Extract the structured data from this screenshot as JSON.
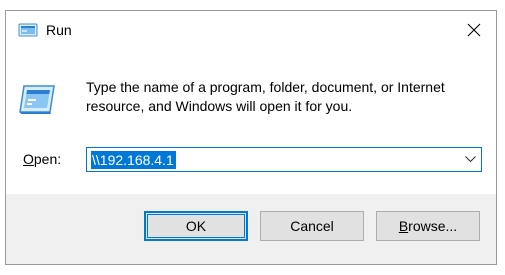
{
  "window": {
    "title": "Run",
    "close_glyph": "close-icon",
    "accent": "#0078d7"
  },
  "content": {
    "description_line1": "Type the name of a program, folder, document, or Internet",
    "description_line2": "resource, and Windows will open it for you.",
    "open_label_access_key": "O",
    "open_label_rest": "pen:",
    "open_value": "\\\\192.168.4.1",
    "open_value_selected": true
  },
  "buttons": {
    "ok_label": "OK",
    "cancel_label": "Cancel",
    "browse_access_key": "B",
    "browse_rest": "rowse..."
  },
  "icons": {
    "title": "run-icon",
    "app": "run-app-icon",
    "dropdown": "chevron-down-icon"
  }
}
